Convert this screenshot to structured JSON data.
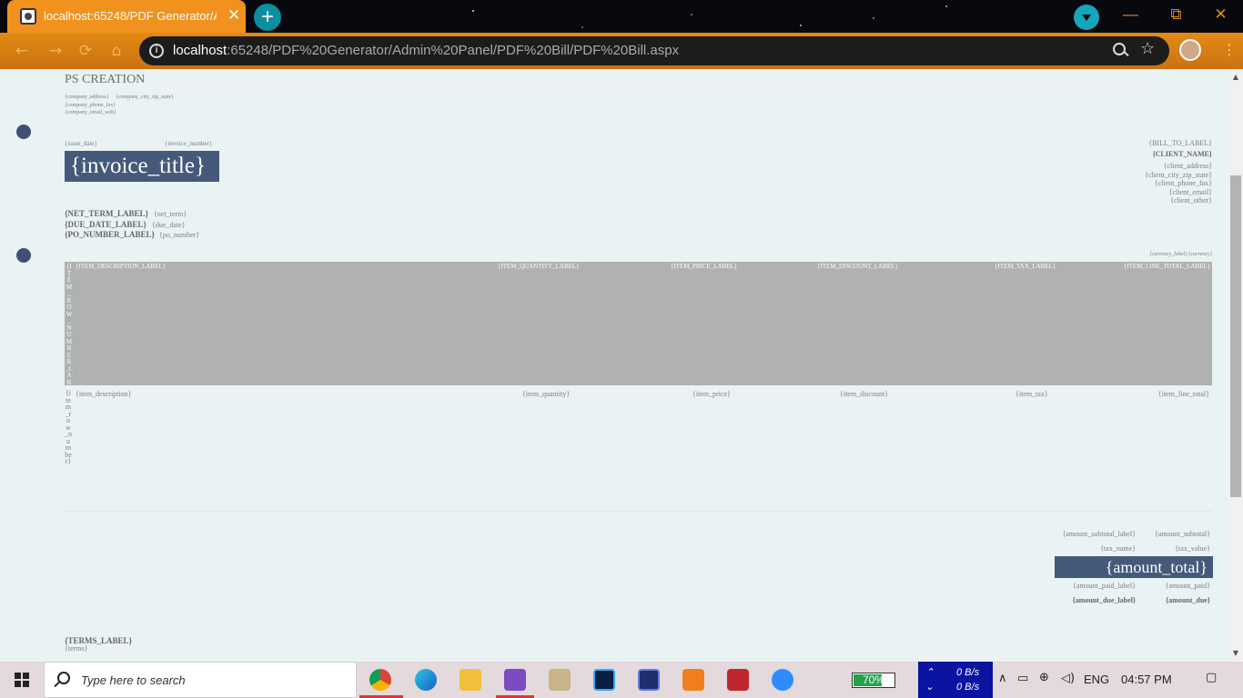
{
  "browser": {
    "tab_title": "localhost:65248/PDF Generator/A",
    "tab_close": "✕",
    "new_tab": "+",
    "url_host": "localhost",
    "url_rest": ":65248/PDF%20Generator/Admin%20Panel/PDF%20Bill/PDF%20Bill.aspx",
    "info_glyph": "i",
    "star_glyph": "☆",
    "menu_glyph": "⋮",
    "minimize": "—",
    "restore": "⧉",
    "close": "✕",
    "nav_back": "←",
    "nav_forward": "→",
    "nav_reload": "⟳",
    "nav_home": "⌂"
  },
  "document": {
    "company_name": "PS CREATION",
    "company_address": "{company_address}",
    "company_city": "{company_city_zip_state}",
    "company_phone": "{company_phone_fax}",
    "company_email": "{company_email_web}",
    "issue_date": "{issue_date}",
    "invoice_number": "{invoice_number}",
    "invoice_title": "{invoice_title}",
    "bill_to_label": "{BILL_TO_LABEL}",
    "client_name": "{CLIENT_NAME}",
    "client_address": "{client_address}",
    "client_city": "{client_city_zip_state}",
    "client_phone": "{client_phone_fax}",
    "client_email": "{client_email}",
    "client_other": "{client_other}",
    "net_term_label": "{NET_TERM_LABEL}",
    "net_term": "{net_term}",
    "due_date_label": "{DUE_DATE_LABEL}",
    "due_date": "{due_date}",
    "po_number_label": "{PO_NUMBER_LABEL}",
    "po_number": "{po_number}",
    "currency": "{currency_label} {currency}",
    "table_headers": {
      "row_number": "{ITEM_ROW_NUMBER_LABEL}",
      "description": "{ITEM_DESCRIPTION_LABEL}",
      "quantity": "{ITEM_QUANTITY_LABEL}",
      "price": "{ITEM_PRICE_LABEL}",
      "discount": "{ITEM_DISCOUNT_LABEL}",
      "tax": "{ITEM_TAX_LABEL}",
      "line_total": "{ITEM_LINE_TOTAL_LABEL}"
    },
    "item_row": {
      "row_number": "{item_row_number}",
      "description": "{item_description}",
      "quantity": "{item_quantity}",
      "price": "{item_price}",
      "discount": "{item_discount}",
      "tax": "{item_tax}",
      "line_total": "{item_line_total}"
    },
    "amount_subtotal_label": "{amount_subtotal_label}",
    "amount_subtotal": "{amount_subtotal}",
    "tax_name": "{tax_name}",
    "tax_value": "{tax_value}",
    "amount_total": "{amount_total}",
    "amount_paid_label": "{amount_paid_label}",
    "amount_paid": "{amount_paid}",
    "amount_due_label": "{amount_due_label}",
    "amount_due": "{amount_due}",
    "terms_label": "{TERMS_LABEL}",
    "terms": "{terms}"
  },
  "taskbar": {
    "search_placeholder": "Type here to search",
    "battery": "70%",
    "battery_level": 0.7,
    "net_up": "0 B/s",
    "net_down": "0 B/s",
    "language": "ENG",
    "time": "04:57 PM"
  },
  "colors": {
    "accent": "#f0921d",
    "page_bg": "#e9f3f3",
    "header_bg": "#45597a",
    "table_header": "#b0b2b1"
  }
}
